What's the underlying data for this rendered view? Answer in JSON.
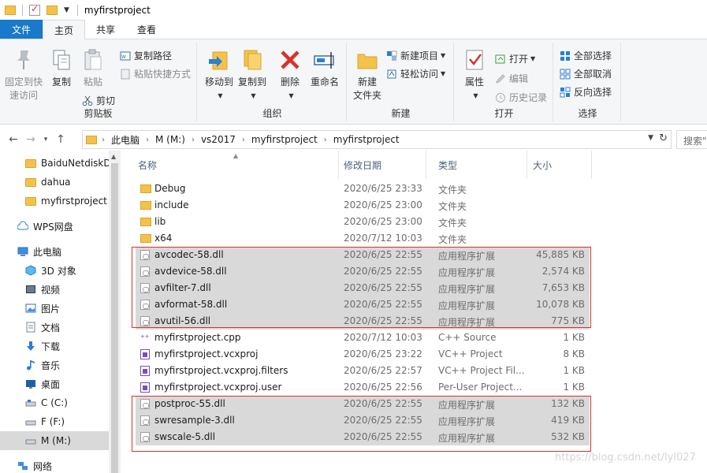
{
  "window": {
    "title": "myfirstproject"
  },
  "tabs": [
    {
      "label": "文件"
    },
    {
      "label": "主页"
    },
    {
      "label": "共享"
    },
    {
      "label": "查看"
    }
  ],
  "ribbon": {
    "clipboard": {
      "label": "剪贴板",
      "pin": "固定到快\n速访问",
      "copy": "复制",
      "paste": "粘贴",
      "copy_path": "复制路径",
      "paste_shortcut": "粘贴快捷方式",
      "cut": "剪切"
    },
    "organize": {
      "label": "组织",
      "move_to": "移动到",
      "copy_to": "复制到",
      "delete": "删除",
      "rename": "重命名"
    },
    "new": {
      "label": "新建",
      "new_folder": "新建\n文件夹",
      "new_item": "新建项目",
      "easy_access": "轻松访问"
    },
    "open": {
      "label": "打开",
      "properties": "属性",
      "open": "打开",
      "edit": "编辑",
      "history": "历史记录"
    },
    "select": {
      "label": "选择",
      "select_all": "全部选择",
      "select_none": "全部取消",
      "invert": "反向选择"
    }
  },
  "address": {
    "crumbs": [
      "此电脑",
      "M (M:)",
      "vs2017",
      "myfirstproject",
      "myfirstproject"
    ],
    "search_placeholder": "搜索\"myfirstproject\""
  },
  "navpane": {
    "items": [
      {
        "label": "BaiduNetdiskD",
        "icon": "folder-icon"
      },
      {
        "label": "dahua",
        "icon": "folder-icon"
      },
      {
        "label": "myfirstproject",
        "icon": "folder-icon"
      },
      {
        "label": "WPS网盘",
        "icon": "cloud-icon"
      },
      {
        "label": "此电脑",
        "icon": "computer-icon"
      },
      {
        "label": "3D 对象",
        "icon": "cube-icon"
      },
      {
        "label": "视频",
        "icon": "video-icon"
      },
      {
        "label": "图片",
        "icon": "picture-icon"
      },
      {
        "label": "文档",
        "icon": "document-icon"
      },
      {
        "label": "下载",
        "icon": "download-icon"
      },
      {
        "label": "音乐",
        "icon": "music-icon"
      },
      {
        "label": "桌面",
        "icon": "desktop-icon"
      },
      {
        "label": "C (C:)",
        "icon": "drive-icon"
      },
      {
        "label": "F (F:)",
        "icon": "drive-icon"
      },
      {
        "label": "M (M:)",
        "icon": "drive-icon"
      },
      {
        "label": "网络",
        "icon": "network-icon"
      }
    ]
  },
  "columns": {
    "name": "名称",
    "date": "修改日期",
    "type": "类型",
    "size": "大小"
  },
  "files": [
    {
      "name": "Debug",
      "date": "2020/6/25 23:33",
      "type": "文件夹",
      "size": "",
      "icon": "folder-icon"
    },
    {
      "name": "include",
      "date": "2020/6/25 23:00",
      "type": "文件夹",
      "size": "",
      "icon": "folder-icon"
    },
    {
      "name": "lib",
      "date": "2020/6/25 23:00",
      "type": "文件夹",
      "size": "",
      "icon": "folder-icon"
    },
    {
      "name": "x64",
      "date": "2020/7/12 10:03",
      "type": "文件夹",
      "size": "",
      "icon": "folder-icon"
    },
    {
      "name": "avcodec-58.dll",
      "date": "2020/6/25 22:55",
      "type": "应用程序扩展",
      "size": "45,885 KB",
      "icon": "dll-icon"
    },
    {
      "name": "avdevice-58.dll",
      "date": "2020/6/25 22:55",
      "type": "应用程序扩展",
      "size": "2,574 KB",
      "icon": "dll-icon"
    },
    {
      "name": "avfilter-7.dll",
      "date": "2020/6/25 22:55",
      "type": "应用程序扩展",
      "size": "7,653 KB",
      "icon": "dll-icon"
    },
    {
      "name": "avformat-58.dll",
      "date": "2020/6/25 22:55",
      "type": "应用程序扩展",
      "size": "10,078 KB",
      "icon": "dll-icon"
    },
    {
      "name": "avutil-56.dll",
      "date": "2020/6/25 22:55",
      "type": "应用程序扩展",
      "size": "775 KB",
      "icon": "dll-icon"
    },
    {
      "name": "myfirstproject.cpp",
      "date": "2020/7/12 10:03",
      "type": "C++ Source",
      "size": "1 KB",
      "icon": "cpp-icon"
    },
    {
      "name": "myfirstproject.vcxproj",
      "date": "2020/6/25 23:22",
      "type": "VC++ Project",
      "size": "8 KB",
      "icon": "vcxproj-icon"
    },
    {
      "name": "myfirstproject.vcxproj.filters",
      "date": "2020/6/25 22:57",
      "type": "VC++ Project Fil...",
      "size": "1 KB",
      "icon": "filters-icon"
    },
    {
      "name": "myfirstproject.vcxproj.user",
      "date": "2020/6/25 22:56",
      "type": "Per-User Project...",
      "size": "1 KB",
      "icon": "user-file-icon"
    },
    {
      "name": "postproc-55.dll",
      "date": "2020/6/25 22:55",
      "type": "应用程序扩展",
      "size": "132 KB",
      "icon": "dll-icon"
    },
    {
      "name": "swresample-3.dll",
      "date": "2020/6/25 22:55",
      "type": "应用程序扩展",
      "size": "419 KB",
      "icon": "dll-icon"
    },
    {
      "name": "swscale-5.dll",
      "date": "2020/6/25 22:55",
      "type": "应用程序扩展",
      "size": "532 KB",
      "icon": "dll-icon"
    }
  ],
  "watermark": "https://blog.csdn.net/lyl027",
  "colors": {
    "accent": "#1979ca",
    "highlight": "#d9d9d9",
    "annotation_red": "#d9312c",
    "folder": "#f4c24a"
  }
}
